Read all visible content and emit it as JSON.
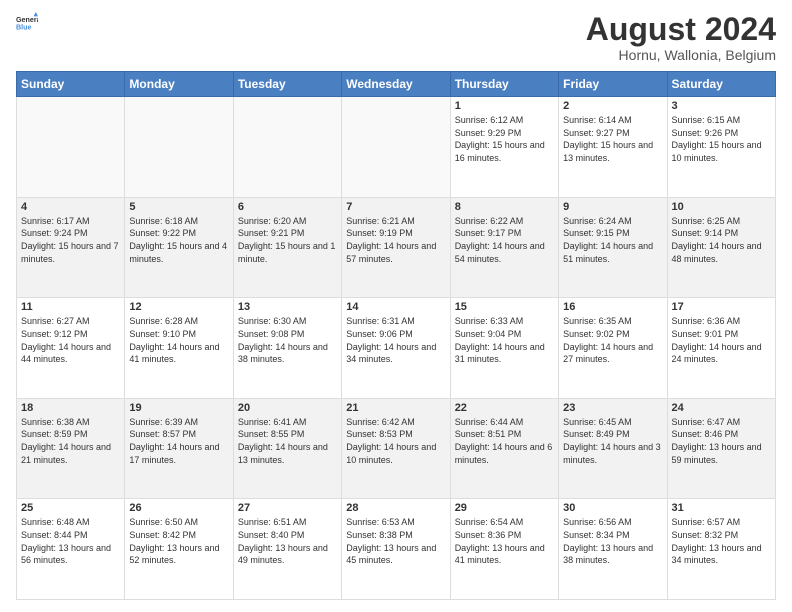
{
  "logo": {
    "general": "General",
    "blue": "Blue"
  },
  "title": "August 2024",
  "subtitle": "Hornu, Wallonia, Belgium",
  "days_of_week": [
    "Sunday",
    "Monday",
    "Tuesday",
    "Wednesday",
    "Thursday",
    "Friday",
    "Saturday"
  ],
  "weeks": [
    [
      {
        "day": "",
        "info": ""
      },
      {
        "day": "",
        "info": ""
      },
      {
        "day": "",
        "info": ""
      },
      {
        "day": "",
        "info": ""
      },
      {
        "day": "1",
        "info": "Sunrise: 6:12 AM\nSunset: 9:29 PM\nDaylight: 15 hours and 16 minutes."
      },
      {
        "day": "2",
        "info": "Sunrise: 6:14 AM\nSunset: 9:27 PM\nDaylight: 15 hours and 13 minutes."
      },
      {
        "day": "3",
        "info": "Sunrise: 6:15 AM\nSunset: 9:26 PM\nDaylight: 15 hours and 10 minutes."
      }
    ],
    [
      {
        "day": "4",
        "info": "Sunrise: 6:17 AM\nSunset: 9:24 PM\nDaylight: 15 hours and 7 minutes."
      },
      {
        "day": "5",
        "info": "Sunrise: 6:18 AM\nSunset: 9:22 PM\nDaylight: 15 hours and 4 minutes."
      },
      {
        "day": "6",
        "info": "Sunrise: 6:20 AM\nSunset: 9:21 PM\nDaylight: 15 hours and 1 minute."
      },
      {
        "day": "7",
        "info": "Sunrise: 6:21 AM\nSunset: 9:19 PM\nDaylight: 14 hours and 57 minutes."
      },
      {
        "day": "8",
        "info": "Sunrise: 6:22 AM\nSunset: 9:17 PM\nDaylight: 14 hours and 54 minutes."
      },
      {
        "day": "9",
        "info": "Sunrise: 6:24 AM\nSunset: 9:15 PM\nDaylight: 14 hours and 51 minutes."
      },
      {
        "day": "10",
        "info": "Sunrise: 6:25 AM\nSunset: 9:14 PM\nDaylight: 14 hours and 48 minutes."
      }
    ],
    [
      {
        "day": "11",
        "info": "Sunrise: 6:27 AM\nSunset: 9:12 PM\nDaylight: 14 hours and 44 minutes."
      },
      {
        "day": "12",
        "info": "Sunrise: 6:28 AM\nSunset: 9:10 PM\nDaylight: 14 hours and 41 minutes."
      },
      {
        "day": "13",
        "info": "Sunrise: 6:30 AM\nSunset: 9:08 PM\nDaylight: 14 hours and 38 minutes."
      },
      {
        "day": "14",
        "info": "Sunrise: 6:31 AM\nSunset: 9:06 PM\nDaylight: 14 hours and 34 minutes."
      },
      {
        "day": "15",
        "info": "Sunrise: 6:33 AM\nSunset: 9:04 PM\nDaylight: 14 hours and 31 minutes."
      },
      {
        "day": "16",
        "info": "Sunrise: 6:35 AM\nSunset: 9:02 PM\nDaylight: 14 hours and 27 minutes."
      },
      {
        "day": "17",
        "info": "Sunrise: 6:36 AM\nSunset: 9:01 PM\nDaylight: 14 hours and 24 minutes."
      }
    ],
    [
      {
        "day": "18",
        "info": "Sunrise: 6:38 AM\nSunset: 8:59 PM\nDaylight: 14 hours and 21 minutes."
      },
      {
        "day": "19",
        "info": "Sunrise: 6:39 AM\nSunset: 8:57 PM\nDaylight: 14 hours and 17 minutes."
      },
      {
        "day": "20",
        "info": "Sunrise: 6:41 AM\nSunset: 8:55 PM\nDaylight: 14 hours and 13 minutes."
      },
      {
        "day": "21",
        "info": "Sunrise: 6:42 AM\nSunset: 8:53 PM\nDaylight: 14 hours and 10 minutes."
      },
      {
        "day": "22",
        "info": "Sunrise: 6:44 AM\nSunset: 8:51 PM\nDaylight: 14 hours and 6 minutes."
      },
      {
        "day": "23",
        "info": "Sunrise: 6:45 AM\nSunset: 8:49 PM\nDaylight: 14 hours and 3 minutes."
      },
      {
        "day": "24",
        "info": "Sunrise: 6:47 AM\nSunset: 8:46 PM\nDaylight: 13 hours and 59 minutes."
      }
    ],
    [
      {
        "day": "25",
        "info": "Sunrise: 6:48 AM\nSunset: 8:44 PM\nDaylight: 13 hours and 56 minutes."
      },
      {
        "day": "26",
        "info": "Sunrise: 6:50 AM\nSunset: 8:42 PM\nDaylight: 13 hours and 52 minutes."
      },
      {
        "day": "27",
        "info": "Sunrise: 6:51 AM\nSunset: 8:40 PM\nDaylight: 13 hours and 49 minutes."
      },
      {
        "day": "28",
        "info": "Sunrise: 6:53 AM\nSunset: 8:38 PM\nDaylight: 13 hours and 45 minutes."
      },
      {
        "day": "29",
        "info": "Sunrise: 6:54 AM\nSunset: 8:36 PM\nDaylight: 13 hours and 41 minutes."
      },
      {
        "day": "30",
        "info": "Sunrise: 6:56 AM\nSunset: 8:34 PM\nDaylight: 13 hours and 38 minutes."
      },
      {
        "day": "31",
        "info": "Sunrise: 6:57 AM\nSunset: 8:32 PM\nDaylight: 13 hours and 34 minutes."
      }
    ]
  ]
}
